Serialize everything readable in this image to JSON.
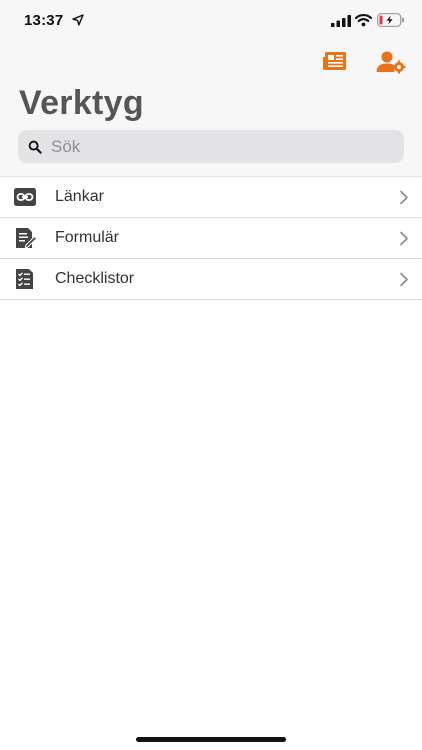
{
  "status_bar": {
    "time": "13:37",
    "icons": [
      "location-arrow-icon",
      "cellular-signal-icon",
      "wifi-icon",
      "battery-charging-icon"
    ]
  },
  "nav": {
    "title": "Verktyg",
    "actions": [
      {
        "icon": "newspaper-icon"
      },
      {
        "icon": "user-settings-icon"
      }
    ]
  },
  "search": {
    "placeholder": "Sök",
    "value": ""
  },
  "list": {
    "items": [
      {
        "label": "Länkar",
        "icon": "link-icon"
      },
      {
        "label": "Formulär",
        "icon": "form-edit-icon"
      },
      {
        "label": "Checklistor",
        "icon": "checklist-icon"
      }
    ]
  },
  "colors": {
    "accent": "#e8731a",
    "title": "#555555",
    "icon_dark": "#444444",
    "battery_low": "#e0383e"
  }
}
